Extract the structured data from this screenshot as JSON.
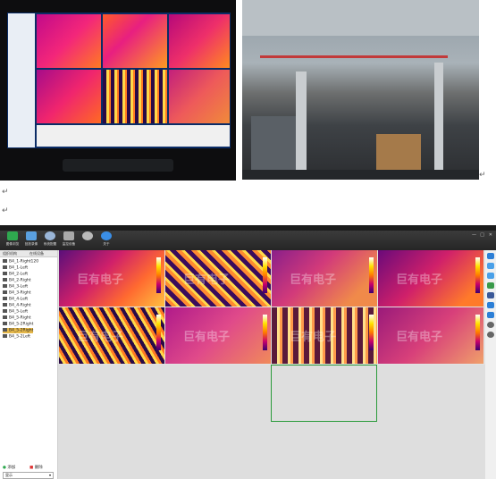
{
  "document": {
    "return_marks": [
      "↵",
      "↵",
      "↵"
    ]
  },
  "app": {
    "toolbar": [
      {
        "label": "图像浏览",
        "color": "#2fa84f"
      },
      {
        "label": "回放录像",
        "color": "#5aa0e0"
      },
      {
        "label": "系统配置",
        "color": "#9ab6d8"
      },
      {
        "label": "监控设备",
        "color": "#aaaaaa"
      },
      {
        "label": "",
        "color": "#bbbbbb"
      },
      {
        "label": "关于",
        "color": "#3a8ee6"
      }
    ],
    "window_controls": [
      "—",
      "□",
      "✕"
    ],
    "sidebar": {
      "tabs": [
        "组织机构",
        "在线设备"
      ],
      "items": [
        "B4_1-Right120",
        "B4_1-Left",
        "B4_2-Left",
        "B4_2-Right",
        "B4_3-Left",
        "B4_3-Right",
        "B4_4-Left",
        "B4_4-Right",
        "B4_5-Left",
        "B4_5-Right",
        "B4_5-2Right",
        "B4_5-2Right",
        "B4_5-2Left"
      ],
      "selected_index": 11,
      "buttons": {
        "add": "添加",
        "delete": "删除"
      },
      "dropdown": "显示"
    },
    "watermark": "巨有电子",
    "right_toolbar_icons": [
      "grid-icon",
      "layout-icon",
      "layout-icon",
      "layout-icon",
      "facebook-icon",
      "arrow-icon",
      "arrow-icon",
      "zoom-in-icon",
      "zoom-out-icon"
    ]
  }
}
